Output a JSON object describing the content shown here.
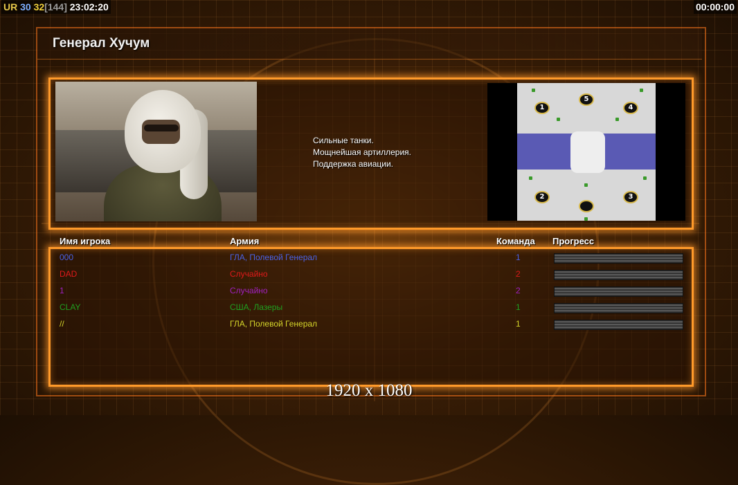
{
  "hud": {
    "ur": "UR",
    "v30": "30",
    "v32": "32",
    "v144": "[144]",
    "clock": "23:02:20",
    "timer": "00:00:00"
  },
  "title": "Генерал Хучум",
  "description": [
    "Сильные танки.",
    "Мощнейшая артиллерия.",
    "Поддержка авиации."
  ],
  "minimap": {
    "spots": [
      "1",
      "5",
      "4",
      "2",
      "3"
    ]
  },
  "table": {
    "headers": {
      "name": "Имя игрока",
      "army": "Армия",
      "team": "Команда",
      "progress": "Прогресс"
    },
    "rows": [
      {
        "name": "000",
        "army": "ГЛА, Полевой Генерал",
        "team": "1",
        "color": "#4a62e6"
      },
      {
        "name": "DAD",
        "army": "Случайно",
        "team": "2",
        "color": "#e01a1a"
      },
      {
        "name": "1",
        "army": "Случайно",
        "team": "2",
        "color": "#a020c0"
      },
      {
        "name": "CLAY",
        "army": "США, Лазеры",
        "team": "1",
        "color": "#20a020"
      },
      {
        "name": "//",
        "army": "ГЛА, Полевой Генерал",
        "team": "1",
        "color": "#d6d62a"
      }
    ]
  },
  "resolution": "1920 x 1080"
}
